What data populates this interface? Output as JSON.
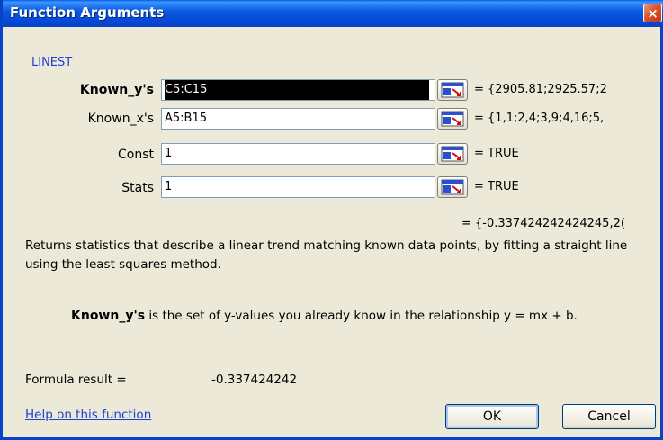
{
  "window": {
    "title": "Function Arguments",
    "close_glyph": "×"
  },
  "function_name": "LINEST",
  "arguments": [
    {
      "label": "Known_y's",
      "value": "C5:C15",
      "evaluated": "= {2905.81;2925.57;2"
    },
    {
      "label": "Known_x's",
      "value": "A5:B15",
      "evaluated": "= {1,1;2,4;3,9;4,16;5,"
    },
    {
      "label": "Const",
      "value": "1",
      "evaluated": "= TRUE"
    },
    {
      "label": "Stats",
      "value": "1",
      "evaluated": "= TRUE"
    }
  ],
  "function_result": "= {-0.337424242424245,2(",
  "description": "Returns statistics that describe a linear trend matching known data points, by fitting a straight line using the least squares method.",
  "argument_help": {
    "name": "Known_y's",
    "text": " is the set of y-values you already know in the relationship y = mx + b."
  },
  "formula_result": {
    "label": "Formula result =",
    "value": "-0.337424242"
  },
  "help_link": "Help on this function",
  "buttons": {
    "ok": "OK",
    "cancel": "Cancel"
  },
  "icons": {
    "close": "close-icon",
    "collapse": "collapse-dialog-icon"
  },
  "colors": {
    "titlebar": "#0a5ae0",
    "link": "#1f3fd0",
    "dialog_bg": "#ece9d8"
  }
}
